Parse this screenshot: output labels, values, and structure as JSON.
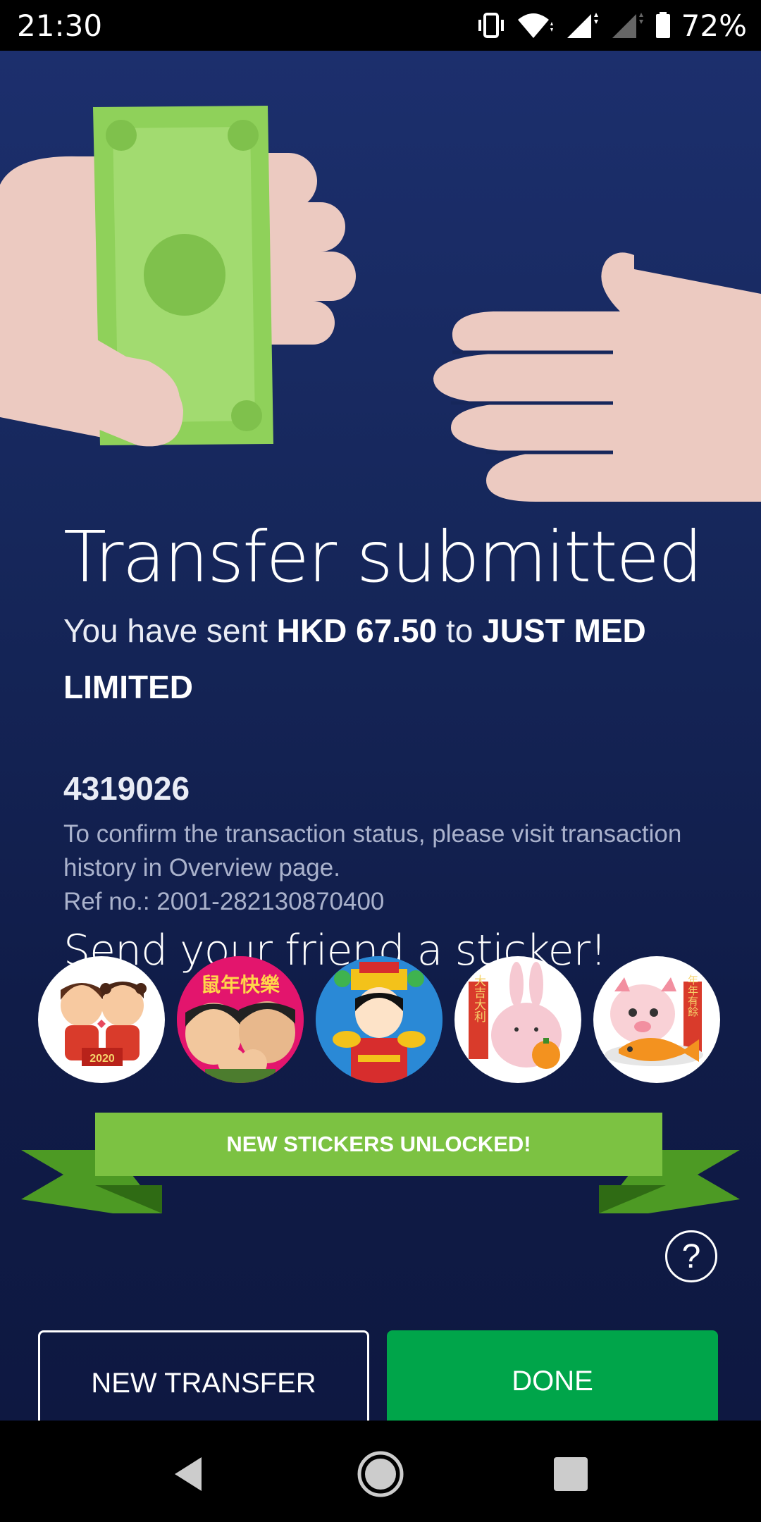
{
  "status_bar": {
    "time": "21:30",
    "battery_percent": "72%",
    "battery_level": 0.72,
    "icons": [
      "vibrate-icon",
      "wifi-icon",
      "signal-icon",
      "signal-empty-icon",
      "battery-icon"
    ]
  },
  "header": {
    "title": "Transfer submitted"
  },
  "confirmation": {
    "prefix": "You have sent ",
    "amount": "HKD 67.50",
    "middle": " to ",
    "recipient": "JUST MED LIMITED",
    "account_number": "4319026",
    "note": "To confirm the transaction status, please visit transaction history in Overview page.",
    "ref_label": "Ref no.: ",
    "ref_number": "2001-282130870400"
  },
  "stickers": {
    "title": "Send your friend a sticker!",
    "items": [
      {
        "name": "sticker-couple-2020",
        "badge": "2020"
      },
      {
        "name": "sticker-rat-year-family",
        "caption": "鼠年快樂"
      },
      {
        "name": "sticker-god-of-wealth"
      },
      {
        "name": "sticker-bunny-tangerine",
        "caption": "大吉大利"
      },
      {
        "name": "sticker-pig-fish",
        "caption": "年年有餘"
      }
    ],
    "banner": "NEW STICKERS UNLOCKED!"
  },
  "help_icon": "?",
  "actions": {
    "new_transfer": "NEW TRANSFER",
    "done": "DONE"
  },
  "colors": {
    "background": "#16275b",
    "ribbon": "#7cc242",
    "done_button": "#00a54a",
    "money": "#8fd15a"
  },
  "nav_bar": {
    "icons": [
      "back-icon",
      "home-icon",
      "recents-icon"
    ]
  }
}
